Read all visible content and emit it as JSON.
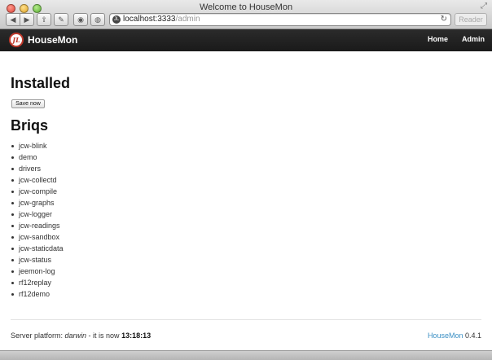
{
  "window": {
    "title": "Welcome to HouseMon",
    "url_host": "localhost:3333",
    "url_path": "/admin",
    "reader_label": "Reader"
  },
  "navbar": {
    "brand": "HouseMon",
    "logo_text": "JL",
    "links": [
      "Home",
      "Admin"
    ]
  },
  "installed": {
    "heading": "Installed",
    "save_button": "Save now"
  },
  "briqs": {
    "heading": "Briqs",
    "items": [
      "jcw-blink",
      "demo",
      "drivers",
      "jcw-collectd",
      "jcw-compile",
      "jcw-graphs",
      "jcw-logger",
      "jcw-readings",
      "jcw-sandbox",
      "jcw-staticdata",
      "jcw-status",
      "jeemon-log",
      "rf12replay",
      "rf12demo"
    ]
  },
  "footer": {
    "platform_prefix": "Server platform: ",
    "platform": "darwin",
    "time_prefix": " - it is now ",
    "time": "13:18:13",
    "brand_link": "HouseMon",
    "version": " 0.4.1"
  },
  "colors": {
    "navbar_bg": "#1a1a1a",
    "link": "#3a8fc4",
    "logo_accent": "#c0392b"
  }
}
